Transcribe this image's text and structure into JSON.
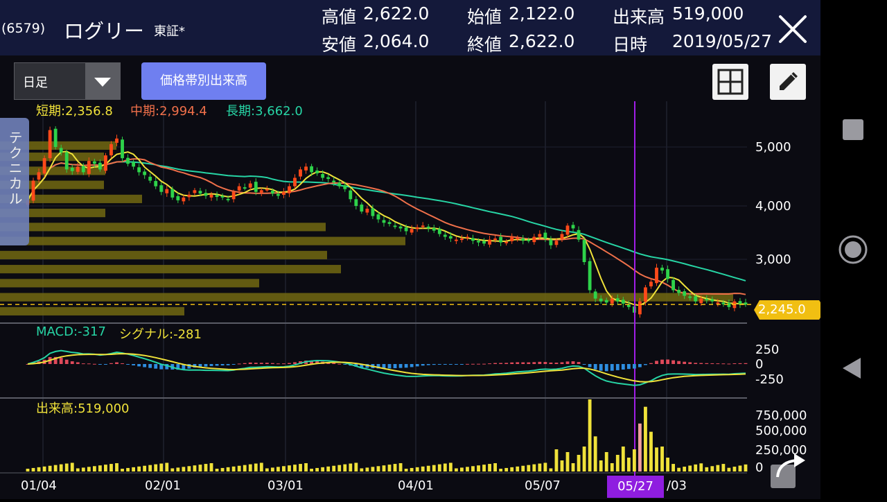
{
  "header": {
    "code": "(6579)",
    "name": "ログリー",
    "exchange": "東証*",
    "stats": [
      {
        "label": "高値",
        "value": "2,622.0"
      },
      {
        "label": "始値",
        "value": "2,122.0"
      },
      {
        "label": "出来高",
        "value": "519,000"
      },
      {
        "label": "安値",
        "value": "2,064.0"
      },
      {
        "label": "終値",
        "value": "2,622.0"
      },
      {
        "label": "日時",
        "value": "2019/05/27"
      }
    ],
    "close_icon": "close-icon"
  },
  "toolbar": {
    "period_selected": "日足",
    "volume_profile_label": "価格帯別出来高",
    "layout_icon": "grid-icon",
    "draw_icon": "pencil-icon"
  },
  "technical_tab": "テクニカル",
  "chart_data": [
    {
      "type": "candlestick",
      "legend": [
        {
          "name": "短期",
          "value": "2,356.8",
          "color": "#f0e23a"
        },
        {
          "name": "中期",
          "value": "2,994.4",
          "color": "#f0704a"
        },
        {
          "name": "長期",
          "value": "3,662.0",
          "color": "#27d5a5"
        }
      ],
      "y_ticks": [
        "5,000",
        "4,000",
        "3,000"
      ],
      "x_ticks": [
        "01/04",
        "02/01",
        "03/01",
        "04/01",
        "05/07",
        "05/27",
        "/03"
      ],
      "selected_date": "05/27",
      "current_price": "2,245.0",
      "ylim": [
        1700,
        6100
      ],
      "closes": [
        4100,
        4450,
        4600,
        4850,
        5350,
        5050,
        4950,
        4650,
        4620,
        4700,
        4600,
        4800,
        4750,
        4650,
        4900,
        5100,
        5200,
        4850,
        4750,
        4700,
        4600,
        4550,
        4450,
        4350,
        4250,
        4300,
        4150,
        4100,
        4150,
        4200,
        4280,
        4220,
        4180,
        4200,
        4160,
        4150,
        4120,
        4250,
        4350,
        4320,
        4400,
        4250,
        4280,
        4300,
        4220,
        4180,
        4250,
        4350,
        4500,
        4650,
        4700,
        4600,
        4580,
        4500,
        4480,
        4420,
        4350,
        4300,
        4120,
        4000,
        3900,
        3950,
        3820,
        3760,
        3700,
        3680,
        3640,
        3600,
        3550,
        3590,
        3620,
        3650,
        3600,
        3560,
        3500,
        3450,
        3420,
        3400,
        3420,
        3450,
        3380,
        3350,
        3330,
        3400,
        3420,
        3350,
        3360,
        3450,
        3430,
        3380,
        3380,
        3450,
        3500,
        3420,
        3300,
        3380,
        3500,
        3650,
        3600,
        3400,
        3000,
        2500,
        2350,
        2300,
        2280,
        2350,
        2300,
        2260,
        2200,
        2100,
        2300,
        2550,
        2650,
        2900,
        2850,
        2700,
        2500,
        2450,
        2400,
        2380,
        2300,
        2350,
        2320,
        2300,
        2280,
        2250,
        2200,
        2300,
        2250,
        2245
      ],
      "volume_profile": [
        {
          "lo": 5000,
          "hi": 5150,
          "len": 168
        },
        {
          "lo": 4800,
          "hi": 4950,
          "len": 150
        },
        {
          "lo": 4550,
          "hi": 4700,
          "len": 152
        },
        {
          "lo": 4300,
          "hi": 4450,
          "len": 150
        },
        {
          "lo": 4050,
          "hi": 4200,
          "len": 205
        },
        {
          "lo": 3800,
          "hi": 3950,
          "len": 152
        },
        {
          "lo": 3550,
          "hi": 3700,
          "len": 470
        },
        {
          "lo": 3300,
          "hi": 3450,
          "len": 585
        },
        {
          "lo": 3050,
          "hi": 3200,
          "len": 472
        },
        {
          "lo": 2800,
          "hi": 2950,
          "len": 492
        },
        {
          "lo": 2550,
          "hi": 2700,
          "len": 374
        },
        {
          "lo": 2300,
          "hi": 2450,
          "len": 1058
        },
        {
          "lo": 2050,
          "hi": 2200,
          "len": 266
        }
      ]
    },
    {
      "type": "line",
      "legend": [
        {
          "name": "MACD",
          "value": "-317",
          "color": "#27d5a5"
        },
        {
          "name": "シグナル",
          "value": "-281",
          "color": "#f0e23a"
        }
      ],
      "y_ticks": [
        "250",
        "0",
        "-250"
      ]
    },
    {
      "type": "bar",
      "legend": [
        {
          "name": "出来高",
          "value": "519,000",
          "color": "#f0e23a"
        }
      ],
      "y_ticks": [
        "750,000",
        "500,000",
        "250,000",
        "0"
      ]
    }
  ],
  "navbar": {
    "recents_icon": "square-icon",
    "home_icon": "circle-icon",
    "back_icon": "back-triangle-icon"
  },
  "scroll_icon": "scroll-arrow-icon"
}
